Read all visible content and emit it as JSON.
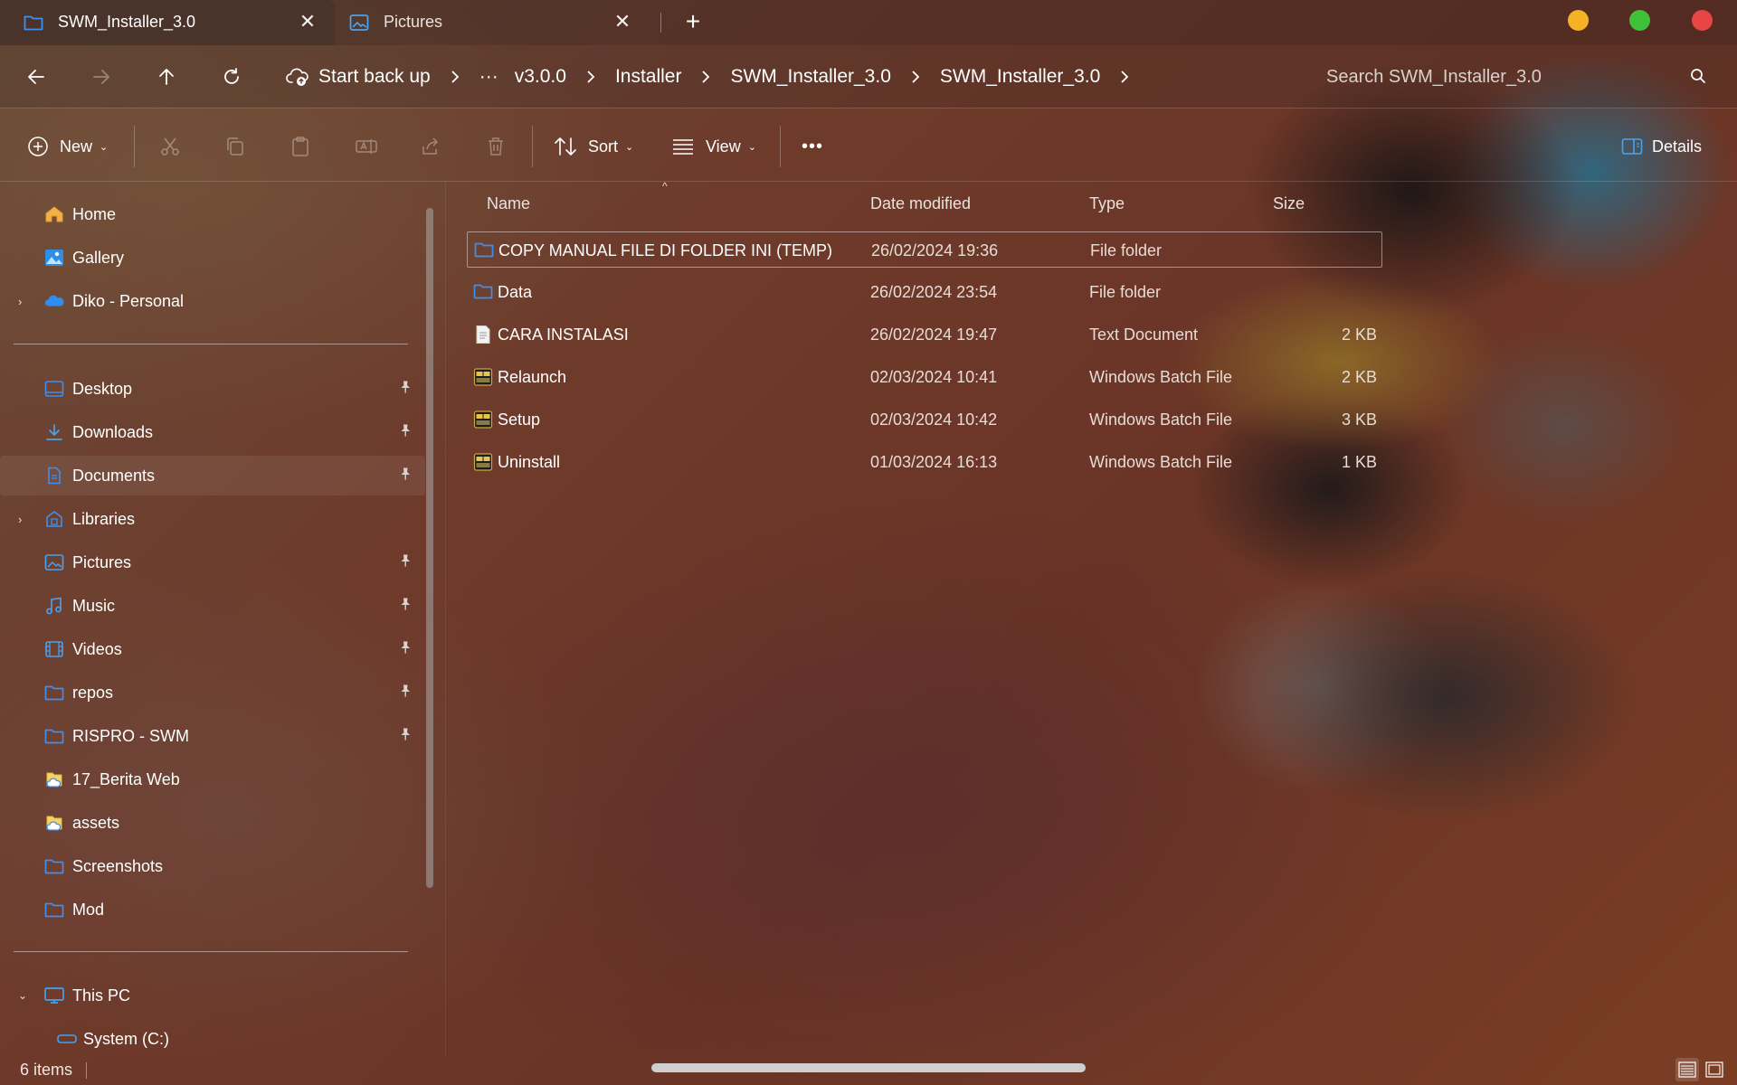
{
  "window": {
    "traffic_colors": {
      "minimize": "#f4b324",
      "maximize": "#3fc13a",
      "close": "#e84545"
    }
  },
  "tabs": [
    {
      "label": "SWM_Installer_3.0",
      "icon": "folder-icon",
      "close_glyph": "✕",
      "active": true
    },
    {
      "label": "Pictures",
      "icon": "pictures-icon",
      "close_glyph": "✕",
      "active": false
    }
  ],
  "new_tab_glyph": "+",
  "navigation": {
    "backup_label": "Start back up",
    "overflow_glyph": "···",
    "breadcrumb": [
      "v3.0.0",
      "Installer",
      "SWM_Installer_3.0",
      "SWM_Installer_3.0"
    ],
    "search_placeholder": "Search SWM_Installer_3.0"
  },
  "command_bar": {
    "new_label": "New",
    "sort_label": "Sort",
    "view_label": "View",
    "more_glyph": "•••",
    "details_label": "Details",
    "disabled_actions": [
      "cut-icon",
      "copy-icon",
      "paste-icon",
      "rename-icon",
      "share-icon",
      "delete-icon"
    ]
  },
  "sidebar": {
    "top_items": [
      {
        "label": "Home",
        "icon": "home-icon"
      },
      {
        "label": "Gallery",
        "icon": "gallery-icon"
      },
      {
        "label": "Diko - Personal",
        "icon": "onedrive-icon",
        "expandable": true
      }
    ],
    "quick_access": [
      {
        "label": "Desktop",
        "icon": "desktop-icon",
        "pinned": true
      },
      {
        "label": "Downloads",
        "icon": "download-icon",
        "pinned": true
      },
      {
        "label": "Documents",
        "icon": "documents-icon",
        "pinned": true,
        "selected": true
      },
      {
        "label": "Libraries",
        "icon": "libraries-icon",
        "expandable": true
      },
      {
        "label": "Pictures",
        "icon": "pictures-icon",
        "pinned": true
      },
      {
        "label": "Music",
        "icon": "music-icon",
        "pinned": true
      },
      {
        "label": "Videos",
        "icon": "videos-icon",
        "pinned": true
      },
      {
        "label": "repos",
        "icon": "folder-icon",
        "pinned": true
      },
      {
        "label": "RISPRO - SWM",
        "icon": "folder-icon",
        "pinned": true
      },
      {
        "label": "17_Berita Web",
        "icon": "cloud-folder-icon"
      },
      {
        "label": "assets",
        "icon": "cloud-folder-icon"
      },
      {
        "label": "Screenshots",
        "icon": "folder-icon"
      },
      {
        "label": "Mod",
        "icon": "folder-icon"
      }
    ],
    "this_pc": {
      "label": "This PC",
      "icon": "computer-icon",
      "expanded": true
    },
    "drives": [
      {
        "label": "System (C:)",
        "icon": "drive-icon"
      }
    ]
  },
  "file_list": {
    "columns": {
      "name": "Name",
      "date": "Date modified",
      "type": "Type",
      "size": "Size"
    },
    "sort_indicator": "^",
    "rows": [
      {
        "name": "COPY MANUAL FILE DI FOLDER INI (TEMP)",
        "date": "26/02/2024 19:36",
        "type": "File folder",
        "size": "",
        "icon": "folder-icon",
        "focused": true
      },
      {
        "name": "Data",
        "date": "26/02/2024 23:54",
        "type": "File folder",
        "size": "",
        "icon": "folder-icon"
      },
      {
        "name": "CARA INSTALASI",
        "date": "26/02/2024 19:47",
        "type": "Text Document",
        "size": "2 KB",
        "icon": "text-document-icon"
      },
      {
        "name": "Relaunch",
        "date": "02/03/2024 10:41",
        "type": "Windows Batch File",
        "size": "2 KB",
        "icon": "batch-file-icon"
      },
      {
        "name": "Setup",
        "date": "02/03/2024 10:42",
        "type": "Windows Batch File",
        "size": "3 KB",
        "icon": "batch-file-icon"
      },
      {
        "name": "Uninstall",
        "date": "01/03/2024 16:13",
        "type": "Windows Batch File",
        "size": "1 KB",
        "icon": "batch-file-icon"
      }
    ]
  },
  "status_bar": {
    "item_count": "6 items"
  },
  "colors": {
    "folder_blue": "#3d8ff0",
    "accent_blue": "#4aa3f0"
  }
}
